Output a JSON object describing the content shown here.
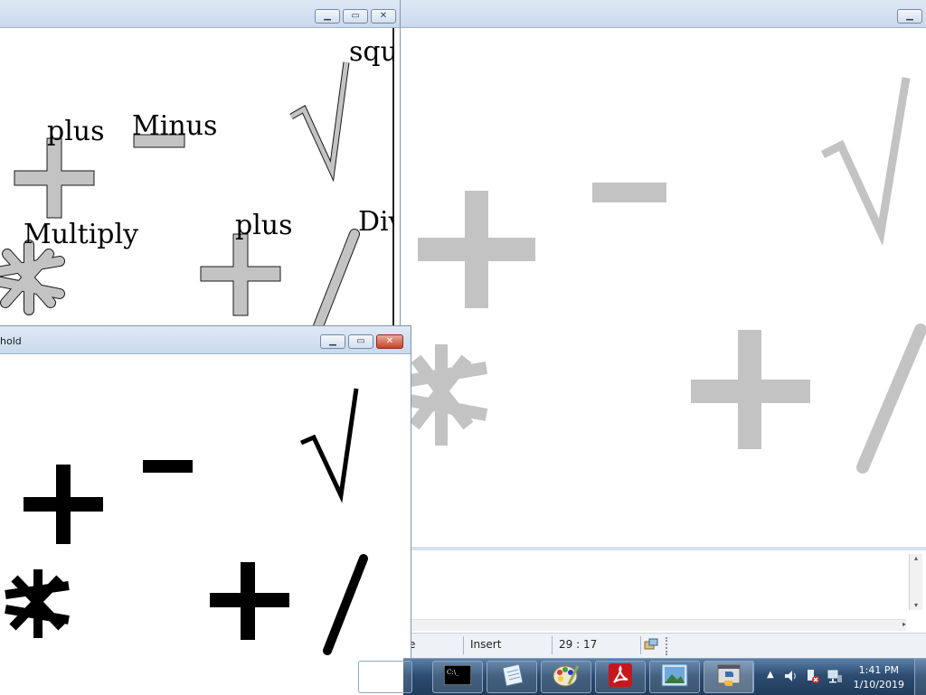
{
  "window_top_left": {
    "labels": {
      "square_root": "squ",
      "plus_1": "plus",
      "minus": "Minus",
      "multiply": "Multiply",
      "plus_2": "plus",
      "divide": "Div"
    }
  },
  "window_threshold": {
    "title": "hold"
  },
  "window_right": {
    "editor_status": {
      "mode_partial": "e",
      "insert": "Insert",
      "position": "29 : 17"
    }
  },
  "taskbar": {
    "items": [
      "cmd-icon",
      "notepad-icon",
      "paint-icon",
      "pdf-reader-icon",
      "photo-viewer-icon",
      "python-icon"
    ],
    "clock": {
      "time": "1:41 PM",
      "date": "1/10/2019"
    }
  },
  "colors": {
    "gray_symbols": "#c3c3c3",
    "black_symbols": "#000000",
    "outline": "#1a1a1a"
  }
}
